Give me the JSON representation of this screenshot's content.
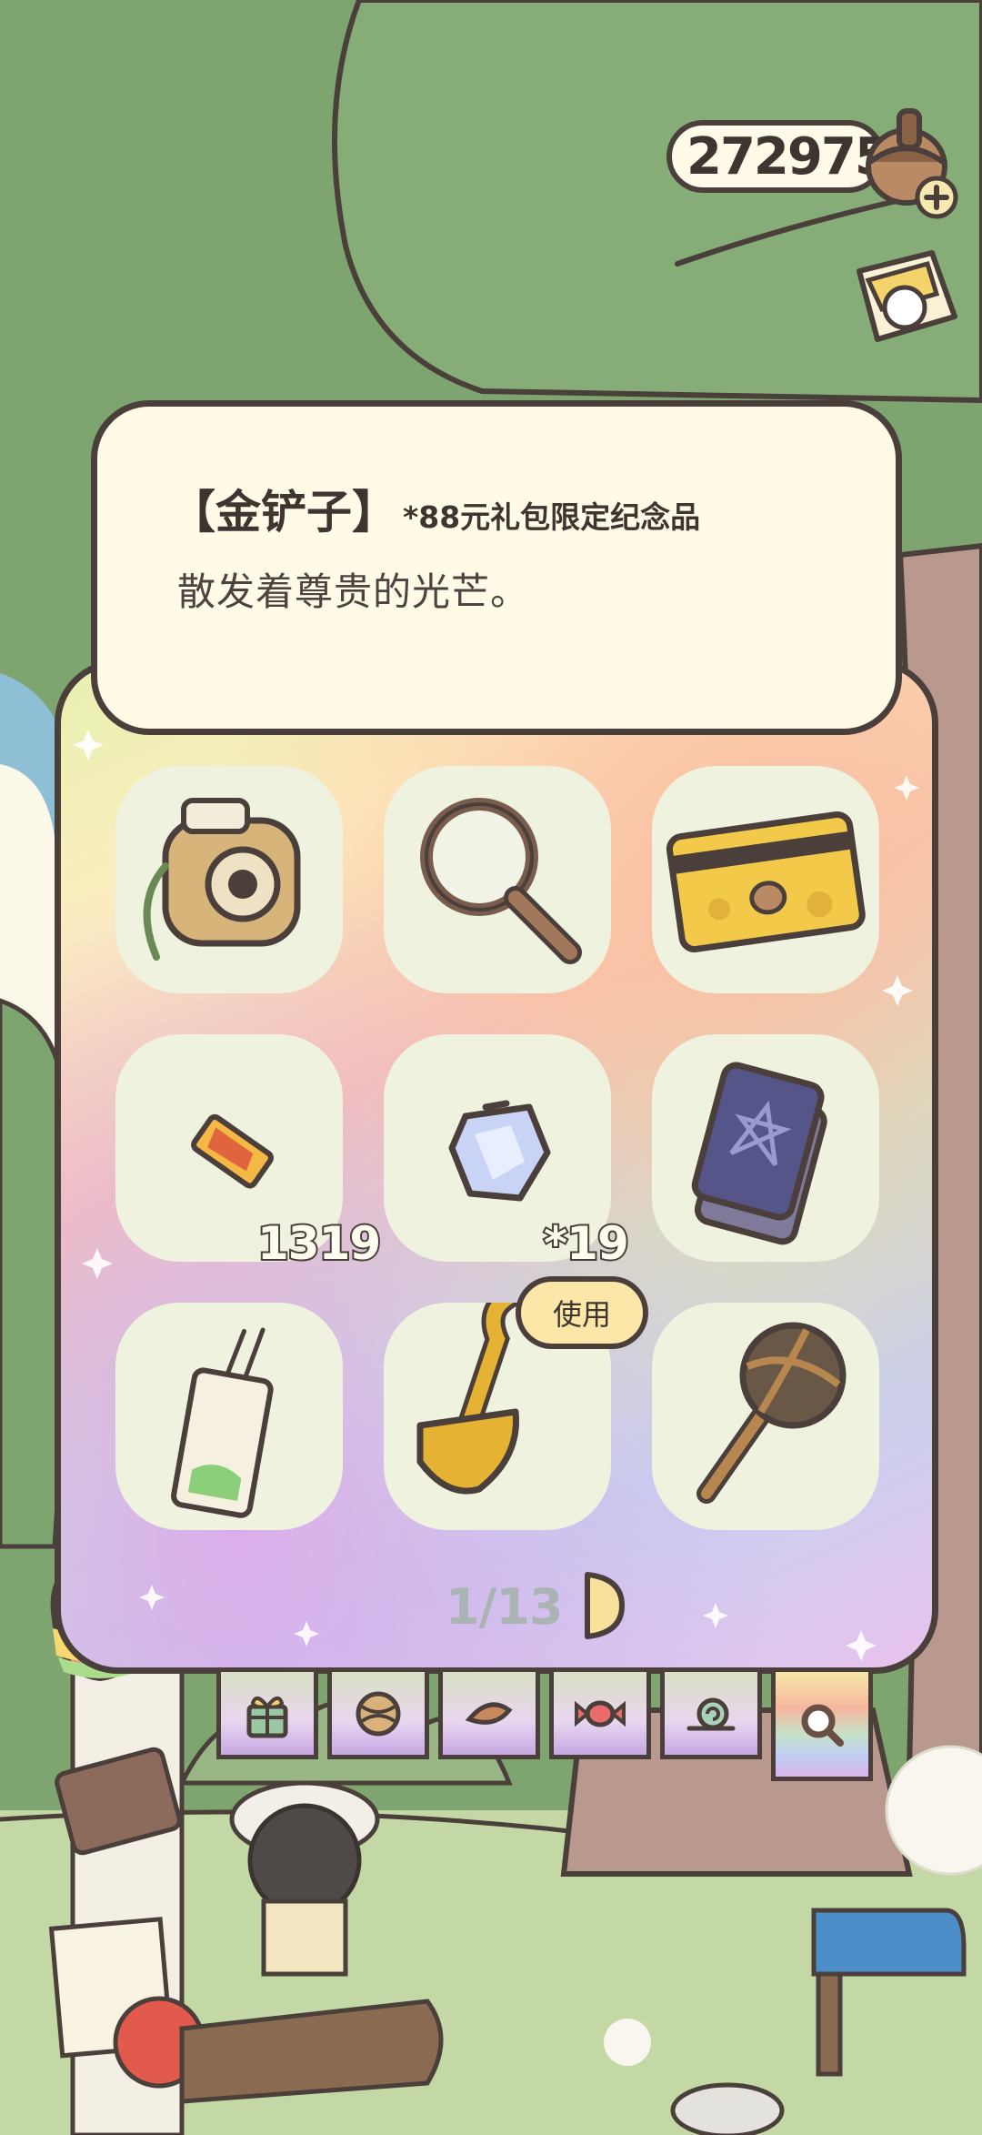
{
  "currency": {
    "value": "272975",
    "icon": "acorn-icon",
    "add_icon": "plus-icon"
  },
  "top_right_icon": "shop-bag-icon",
  "item_detail": {
    "name": "【金铲子】",
    "tag": "*88元礼包限定纪念品",
    "description": "散发着尊贵的光芒。"
  },
  "items": [
    {
      "icon": "camera-icon",
      "count": ""
    },
    {
      "icon": "magnifying-glass-icon",
      "count": ""
    },
    {
      "icon": "membership-card-icon",
      "count": ""
    },
    {
      "icon": "ticket-icon",
      "count": "1319"
    },
    {
      "icon": "crystal-icon",
      "count": "*19"
    },
    {
      "icon": "tarot-cards-icon",
      "count": ""
    },
    {
      "icon": "bookmark-tag-icon",
      "count": ""
    },
    {
      "icon": "golden-shovel-icon",
      "count": "",
      "selected": true
    },
    {
      "icon": "wooden-mallet-icon",
      "count": ""
    }
  ],
  "use_button": {
    "label": "使用"
  },
  "pagination": {
    "label": "1/13",
    "next_icon": "chevron-right-icon"
  },
  "tabs": [
    {
      "icon": "gift-icon"
    },
    {
      "icon": "yarn-ball-icon"
    },
    {
      "icon": "leaf-icon"
    },
    {
      "icon": "candy-icon"
    },
    {
      "icon": "snail-icon"
    },
    {
      "icon": "search-icon",
      "active": true
    }
  ]
}
